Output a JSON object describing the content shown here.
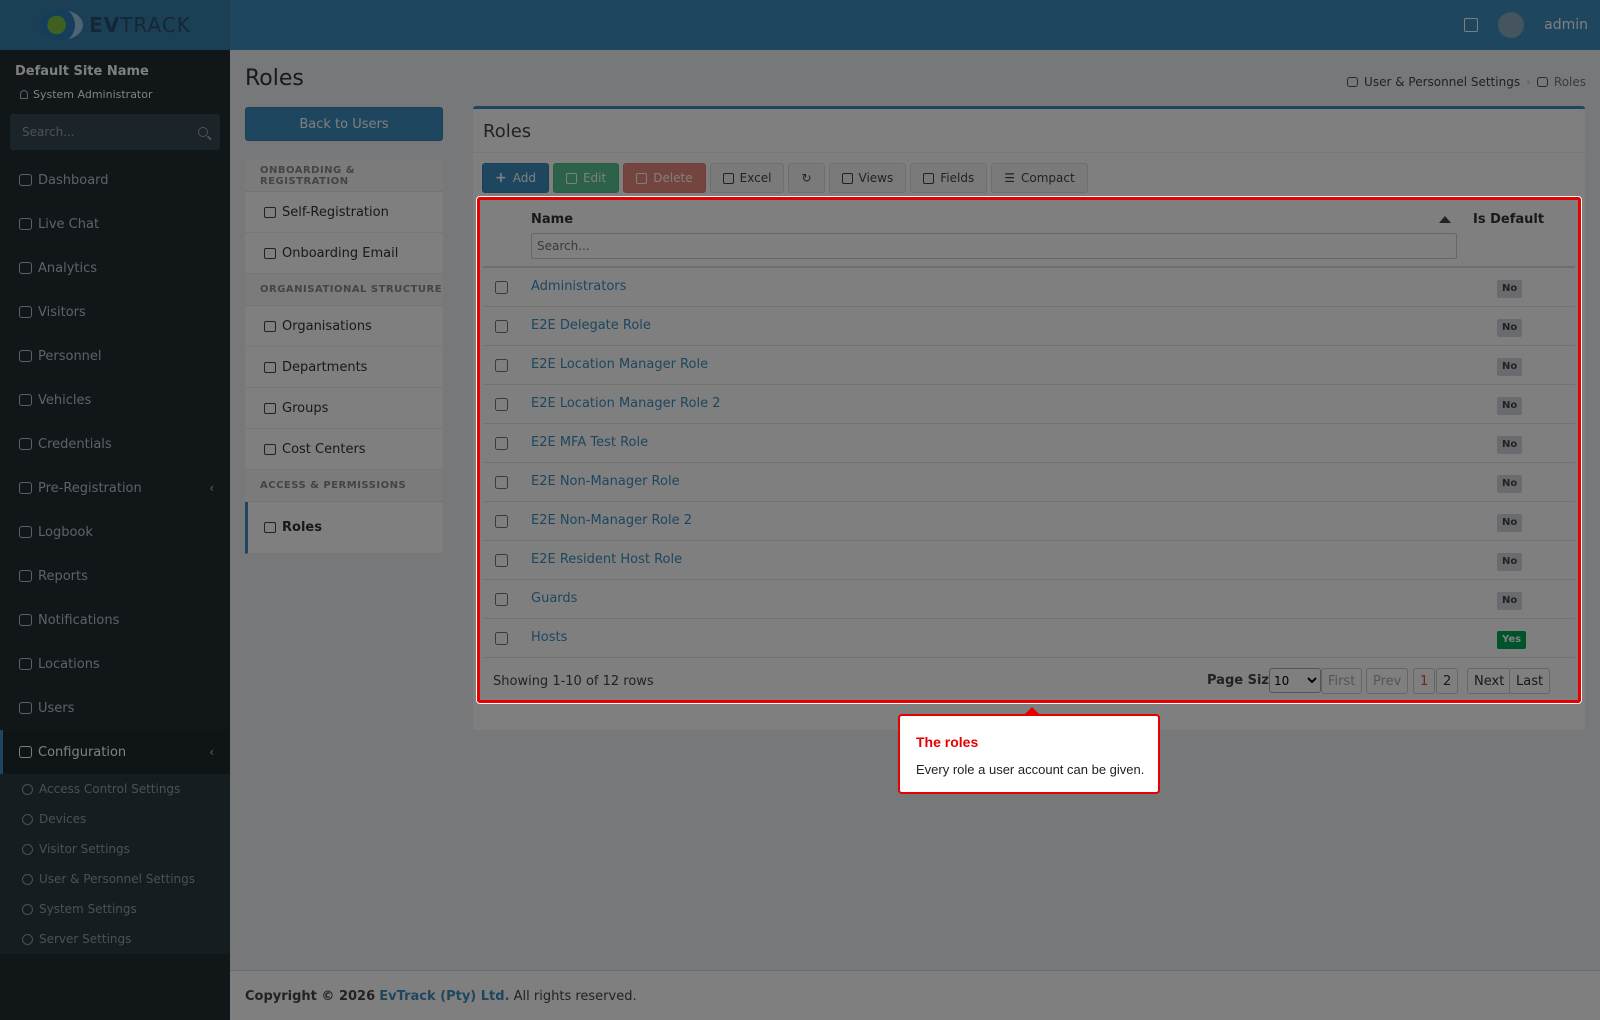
{
  "header": {
    "brand_prefix": "EV",
    "brand_suffix": "TRACK",
    "user": "admin"
  },
  "sidebar": {
    "site_name": "Default Site Name",
    "role": "System Administrator",
    "search_placeholder": "Search...",
    "items": [
      {
        "label": "Dashboard",
        "icon": "dashboard-icon"
      },
      {
        "label": "Live Chat",
        "icon": "headset-icon"
      },
      {
        "label": "Analytics",
        "icon": "target-icon"
      },
      {
        "label": "Visitors",
        "icon": "eye-icon"
      },
      {
        "label": "Personnel",
        "icon": "user-gear-icon"
      },
      {
        "label": "Vehicles",
        "icon": "car-icon"
      },
      {
        "label": "Credentials",
        "icon": "id-card-icon"
      },
      {
        "label": "Pre-Registration",
        "icon": "arrows-icon"
      },
      {
        "label": "Logbook",
        "icon": "book-icon"
      },
      {
        "label": "Reports",
        "icon": "chart-icon"
      },
      {
        "label": "Notifications",
        "icon": "bell-icon"
      },
      {
        "label": "Locations",
        "icon": "map-icon"
      },
      {
        "label": "Users",
        "icon": "users-icon"
      },
      {
        "label": "Configuration",
        "icon": "gear-icon"
      }
    ],
    "config_sub": [
      {
        "label": "Access Control Settings",
        "icon": "lock-icon"
      },
      {
        "label": "Devices",
        "icon": "chip-icon"
      },
      {
        "label": "Visitor Settings",
        "icon": "eye-icon"
      },
      {
        "label": "User & Personnel Settings",
        "icon": "user-gear-icon"
      },
      {
        "label": "System Settings",
        "icon": "sliders-icon"
      },
      {
        "label": "Server Settings",
        "icon": "wrench-icon"
      }
    ]
  },
  "page": {
    "title": "Roles",
    "breadcrumb_parent": "User & Personnel Settings",
    "breadcrumb_current": "Roles",
    "back_label": "Back to Users"
  },
  "left_menu": {
    "sections": [
      {
        "header": "ONBOARDING & REGISTRATION",
        "items": [
          "Self-Registration",
          "Onboarding Email"
        ]
      },
      {
        "header": "ORGANISATIONAL STRUCTURE",
        "items": [
          "Organisations",
          "Departments",
          "Groups",
          "Cost Centers"
        ]
      },
      {
        "header": "ACCESS & PERMISSIONS",
        "items": [
          "Roles"
        ]
      }
    ]
  },
  "box": {
    "title": "Roles",
    "toolbar": {
      "add": "Add",
      "edit": "Edit",
      "delete": "Delete",
      "excel": "Excel",
      "views": "Views",
      "fields": "Fields",
      "compact": "Compact"
    }
  },
  "grid": {
    "col_name": "Name",
    "col_default": "Is Default",
    "search_placeholder": "Search...",
    "rows": [
      {
        "name": "Administrators",
        "default": "No"
      },
      {
        "name": "E2E Delegate Role",
        "default": "No"
      },
      {
        "name": "E2E Location Manager Role",
        "default": "No"
      },
      {
        "name": "E2E Location Manager Role 2",
        "default": "No"
      },
      {
        "name": "E2E MFA Test Role",
        "default": "No"
      },
      {
        "name": "E2E Non-Manager Role",
        "default": "No"
      },
      {
        "name": "E2E Non-Manager Role 2",
        "default": "No"
      },
      {
        "name": "E2E Resident Host Role",
        "default": "No"
      },
      {
        "name": "Guards",
        "default": "No"
      },
      {
        "name": "Hosts",
        "default": "Yes"
      }
    ],
    "showing": "Showing 1-10 of 12 rows",
    "page_size_label": "Page Size",
    "page_size": "10",
    "first": "First",
    "prev": "Prev",
    "page1": "1",
    "page2": "2",
    "next": "Next",
    "last": "Last"
  },
  "footer": {
    "prefix": "Copyright © 2026",
    "company": "EvTrack (Pty) Ltd.",
    "suffix": "All rights reserved."
  },
  "tooltip": {
    "title": "The roles",
    "body": "Every role a user account can be given."
  },
  "colors": {
    "accent": "#3c8dbc",
    "highlight": "#e60000",
    "success": "#00a65a"
  }
}
